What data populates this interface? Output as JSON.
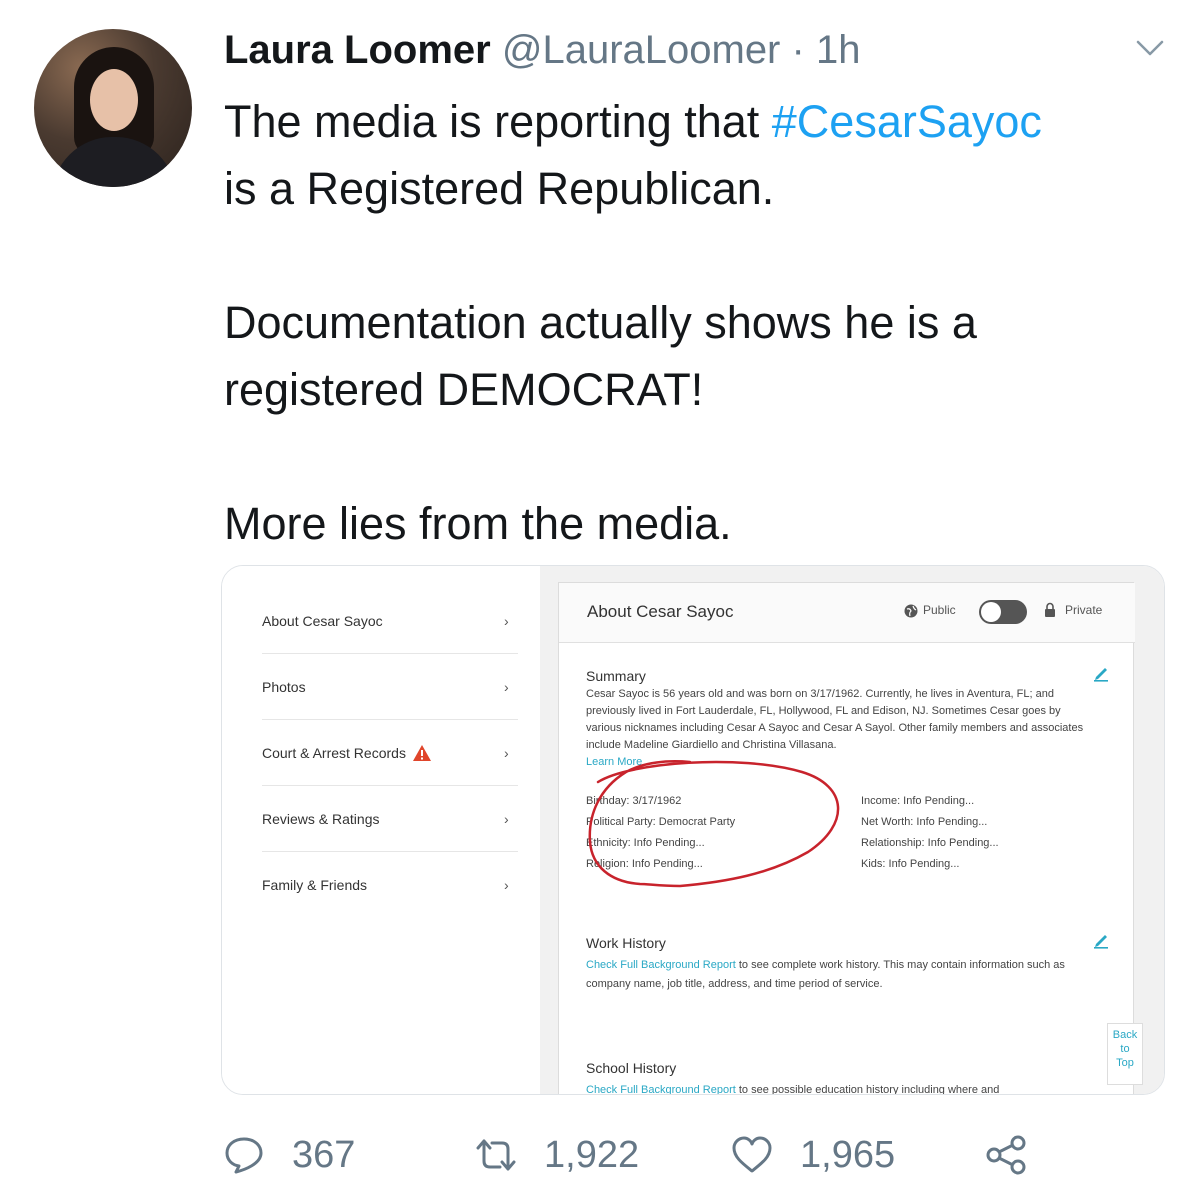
{
  "tweet": {
    "author_name": "Laura Loomer",
    "author_handle": "@LauraLoomer",
    "separator": "·",
    "time": "1h",
    "text": {
      "line1_prefix": "The media is reporting that ",
      "hashtag": "#CesarSayoc",
      "line2": "is a Registered Republican.",
      "line3": "Documentation actually shows he is a",
      "line4": "registered DEMOCRAT!",
      "line5": "More lies from the media."
    },
    "stats": {
      "replies": "367",
      "retweets": "1,922",
      "likes": "1,965"
    }
  },
  "screenshot": {
    "sidebar": [
      {
        "label": "About Cesar Sayoc",
        "arrow": "›"
      },
      {
        "label": "Photos",
        "arrow": "›"
      },
      {
        "label": "Court & Arrest Records",
        "arrow": "›"
      },
      {
        "label": "Reviews & Ratings",
        "arrow": "›"
      },
      {
        "label": "Family & Friends",
        "arrow": "›"
      }
    ],
    "header": {
      "title": "About Cesar Sayoc",
      "public_label": "Public",
      "private_label": "Private"
    },
    "summary": {
      "title": "Summary",
      "text": "Cesar Sayoc is 56 years old and was born on 3/17/1962. Currently, he lives in Aventura, FL; and previously lived in Fort Lauderdale, FL, Hollywood, FL and Edison, NJ. Sometimes Cesar goes by various nicknames including Cesar A Sayoc and Cesar A Sayol. Other family members and associates include Madeline Giardiello and Christina Villasana.",
      "learn_more": "Learn More"
    },
    "details_left": [
      "Birthday: 3/17/1962",
      "Political Party: Democrat Party",
      "Ethnicity: Info Pending...",
      "Religion: Info Pending..."
    ],
    "details_right": [
      "Income: Info Pending...",
      "Net Worth: Info Pending...",
      "Relationship: Info Pending...",
      "Kids: Info Pending..."
    ],
    "work_history": {
      "title": "Work History",
      "link": "Check Full Background Report",
      "text": " to see complete work history. This may contain information such as company name, job title, address, and time period of service."
    },
    "school_history": {
      "title": "School History",
      "link": "Check Full Background Report",
      "text": " to see possible education history including where and"
    },
    "back_to_top": [
      "Back",
      "to",
      "Top"
    ]
  },
  "colors": {
    "hashtag": "#1da1f2",
    "secondary_text": "#657786",
    "annotation": "#c8232c",
    "link": "#2aa8c5"
  }
}
